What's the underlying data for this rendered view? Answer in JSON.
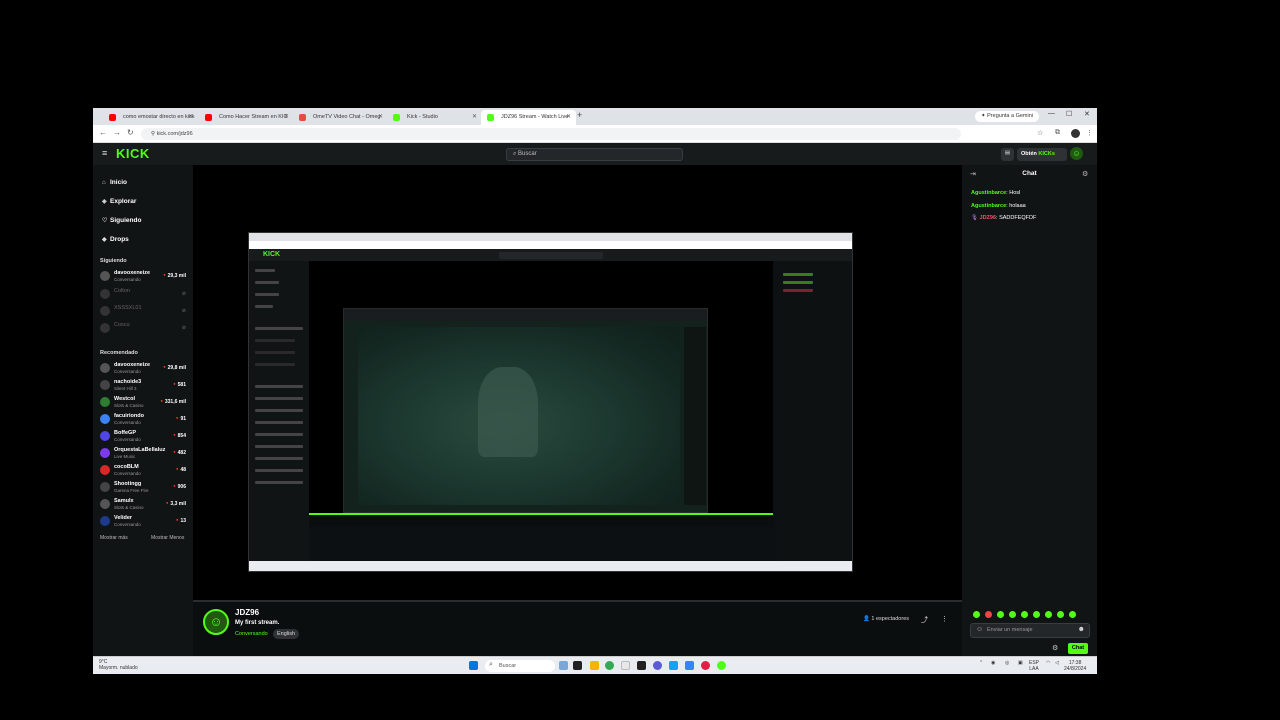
{
  "browser": {
    "tabs": [
      {
        "title": "como emostar directo en kick",
        "favicon_color": "#ff0000"
      },
      {
        "title": "Como Hacer Stream en KIC",
        "favicon_color": "#ff0000"
      },
      {
        "title": "OmeTV Video Chat - Omeg",
        "favicon_color": "#e74c3c"
      },
      {
        "title": "Kick - Studio",
        "favicon_color": "#53fc18"
      },
      {
        "title": "JDZ96 Stream - Watch Live",
        "favicon_color": "#53fc18"
      }
    ],
    "gemini_label": "Pregunta a Gemini",
    "url": "kick.com/jdz96"
  },
  "header": {
    "logo": "KICK",
    "search_placeholder": "Buscar",
    "get_kicks_prefix": "Obtén ",
    "get_kicks_brand": "KICKs"
  },
  "sidebar": {
    "nav": [
      {
        "icon": "home-icon",
        "label": "Inicio"
      },
      {
        "icon": "compass-icon",
        "label": "Explorar"
      },
      {
        "icon": "heart-icon",
        "label": "Siguiendo"
      },
      {
        "icon": "drops-icon",
        "label": "Drops"
      }
    ],
    "following_title": "Siguiendo",
    "following": [
      {
        "name": "davooxeneize",
        "category": "Conversando",
        "viewers": "29,3 mil",
        "color": "#555"
      },
      {
        "name": "Colton",
        "category": "",
        "viewers": "",
        "color": "#333"
      },
      {
        "name": "XSSSXL01",
        "category": "",
        "viewers": "",
        "color": "#333"
      },
      {
        "name": "Coscu",
        "category": "",
        "viewers": "",
        "color": "#333"
      }
    ],
    "recommended_title": "Recomendado",
    "recommended": [
      {
        "name": "davooxeneize",
        "category": "Conversando",
        "viewers": "29,8 mil",
        "color": "#555"
      },
      {
        "name": "nachoide3",
        "category": "Silent Hill 3",
        "viewers": "581",
        "color": "#444"
      },
      {
        "name": "Westcol",
        "category": "Slots & Casino",
        "viewers": "331,6 mil",
        "color": "#2e7d32"
      },
      {
        "name": "facuiriondo",
        "category": "Conversando",
        "viewers": "91",
        "color": "#3b82f6"
      },
      {
        "name": "BoffeGP",
        "category": "Conversando",
        "viewers": "854",
        "color": "#4f46e5"
      },
      {
        "name": "OrquestaLaBellaluz",
        "category": "Live Music",
        "viewers": "482",
        "color": "#7c3aed"
      },
      {
        "name": "cocoBLM",
        "category": "Conversando",
        "viewers": "48",
        "color": "#dc2626"
      },
      {
        "name": "Shootingg",
        "category": "Garena Free Fire",
        "viewers": "906",
        "color": "#444"
      },
      {
        "name": "Samulx",
        "category": "Slots & Casino",
        "viewers": "3,3 mil",
        "color": "#555"
      },
      {
        "name": "Velider",
        "category": "Conversando",
        "viewers": "13",
        "color": "#1e3a8a"
      }
    ],
    "show_more": "Mostrar más",
    "show_less": "Mostrar Menos"
  },
  "stream": {
    "streamer": "JDZ96",
    "title": "My first stream.",
    "category": "Conversando",
    "tag": "English",
    "viewers": "1 espectadores"
  },
  "chat": {
    "title": "Chat",
    "messages": [
      {
        "user": "Agustinbarce",
        "text": "Hosl",
        "color": "#53fc18"
      },
      {
        "user": "Agustinbarce",
        "text": "holaaa",
        "color": "#53fc18"
      },
      {
        "user": "JDZ96",
        "text": "SADDFEQFDF",
        "color": "#ff4d6a"
      }
    ],
    "input_placeholder": "Enviar un mensaje",
    "send_label": "Chat",
    "emote_colors": [
      "#53fc18",
      "#ef4444",
      "#53fc18",
      "#53fc18",
      "#53fc18",
      "#53fc18",
      "#53fc18",
      "#53fc18",
      "#53fc18",
      "#53fc18",
      "#53fc18",
      "#53fc18"
    ]
  },
  "taskbar": {
    "weather_temp": "9°C",
    "weather_desc": "Mayorm. nublado",
    "search_label": "Buscar",
    "lang": "ESP",
    "lang_sub": "LAA",
    "time": "17:38",
    "date": "24/8/2024"
  }
}
